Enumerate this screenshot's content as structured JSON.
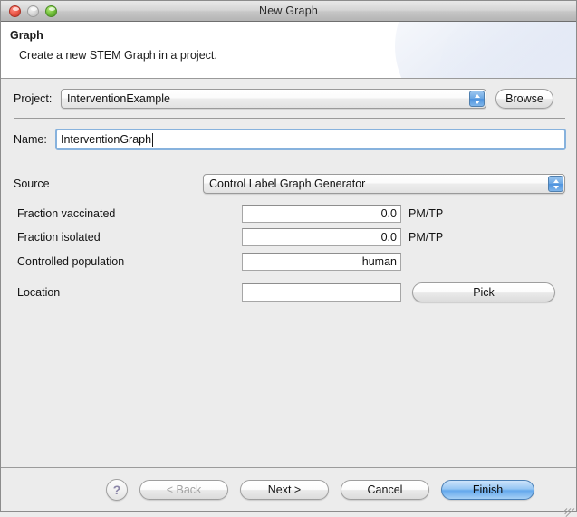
{
  "window": {
    "title": "New Graph",
    "traffic_lights": [
      "close-button",
      "minimize-button",
      "zoom-button"
    ]
  },
  "banner": {
    "title": "Graph",
    "description": "Create a new STEM Graph in a project."
  },
  "form": {
    "project": {
      "label": "Project:",
      "value": "InterventionExample",
      "browse_label": "Browse"
    },
    "name": {
      "label": "Name:",
      "value": "InterventionGraph"
    },
    "source": {
      "label": "Source",
      "value": "Control Label Graph Generator"
    },
    "fields": [
      {
        "label": "Fraction vaccinated",
        "value": "0.0",
        "unit": "PM/TP"
      },
      {
        "label": "Fraction isolated",
        "value": "0.0",
        "unit": "PM/TP"
      },
      {
        "label": "Controlled population",
        "value": "human",
        "unit": ""
      }
    ],
    "location": {
      "label": "Location",
      "value": "",
      "pick_label": "Pick"
    }
  },
  "footer": {
    "help_label": "?",
    "back_label": "< Back",
    "next_label": "Next >",
    "cancel_label": "Cancel",
    "finish_label": "Finish"
  },
  "colors": {
    "accent_blue": "#64a8ec",
    "stepper_blue": "#4e93de",
    "focus_ring": "#87b2dd",
    "window_bg": "#ececec"
  }
}
